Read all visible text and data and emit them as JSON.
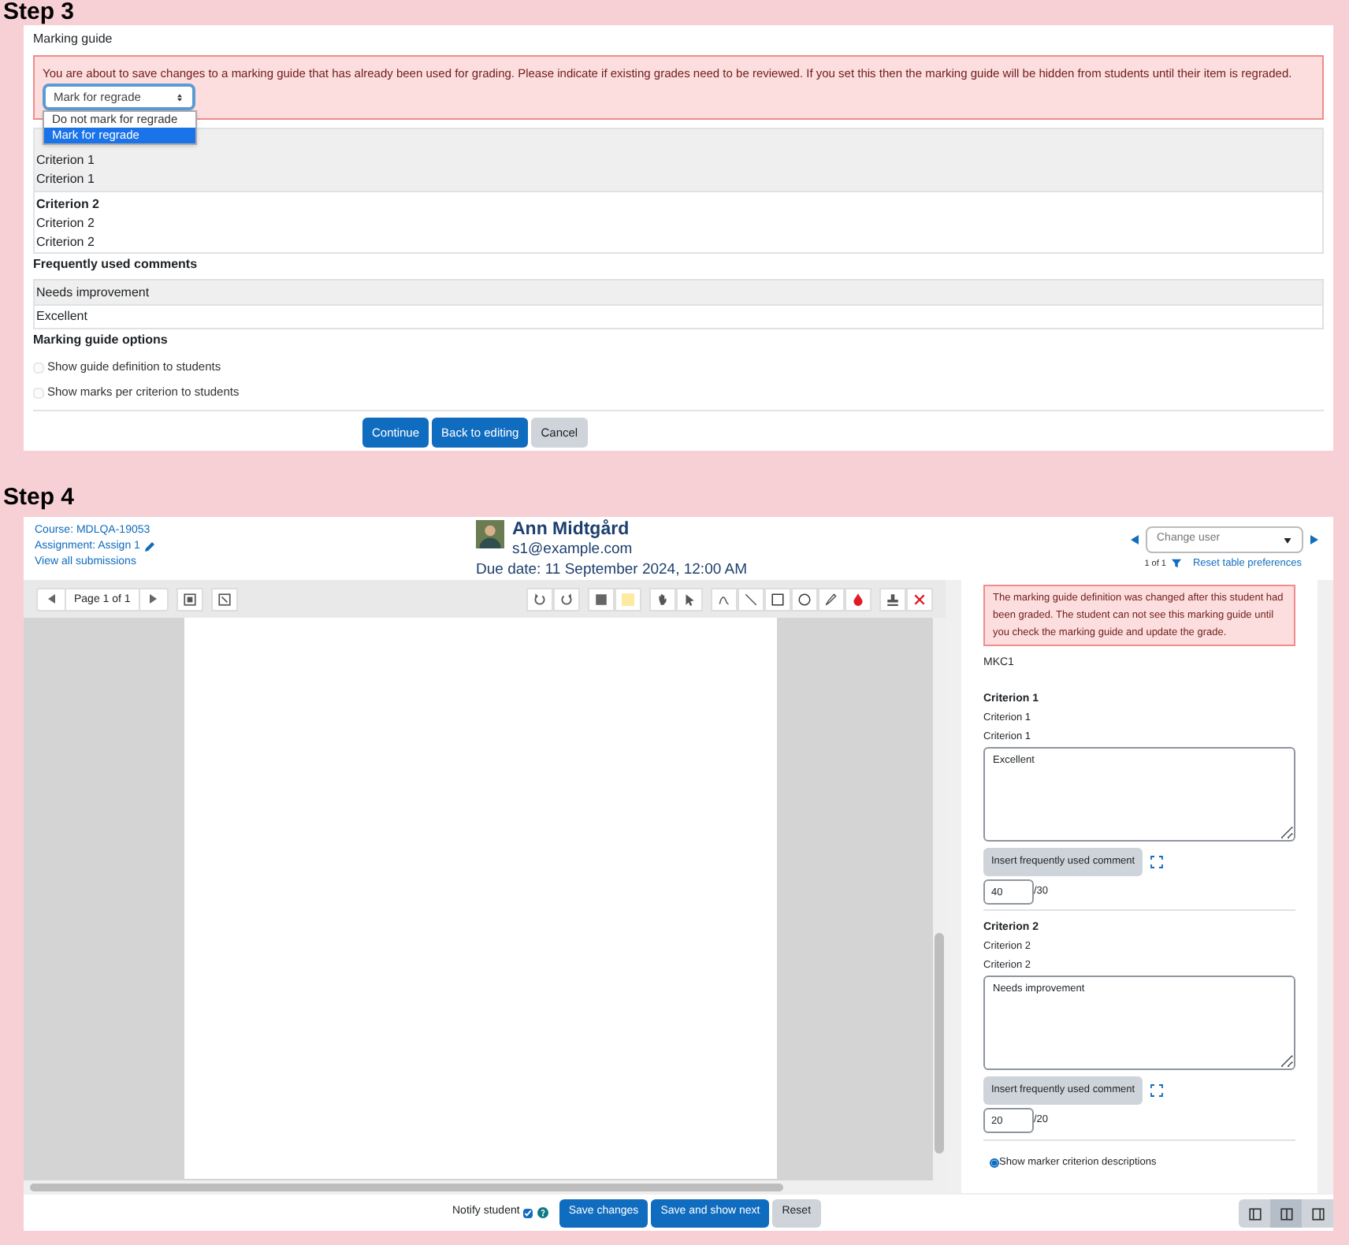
{
  "step3": {
    "heading": "Step 3",
    "section_title": "Marking guide",
    "warning": "You are about to save changes to a marking guide that has already been used for grading. Please indicate if existing grades need to be reviewed. If you set this then the marking guide will be hidden from students until their item is regraded.",
    "regrade_select": {
      "value": "Mark for regrade",
      "expanded": true,
      "options": [
        {
          "label": "Do not mark for regrade",
          "selected": false
        },
        {
          "label": "Mark for regrade",
          "selected": true
        }
      ]
    },
    "criteria": [
      {
        "lines": [
          "Criterion 1",
          "Criterion 1"
        ]
      },
      {
        "title": "Criterion 2",
        "lines": [
          "Criterion 2",
          "Criterion 2"
        ]
      }
    ],
    "comments_heading": "Frequently used comments",
    "comments": [
      "Needs improvement",
      "Excellent"
    ],
    "options_heading": "Marking guide options",
    "options": [
      {
        "label": "Show guide definition to students",
        "checked": false,
        "disabled": true
      },
      {
        "label": "Show marks per criterion to students",
        "checked": false,
        "disabled": true
      }
    ],
    "buttons": [
      {
        "label": "Continue",
        "kind": "primary"
      },
      {
        "label": "Back to editing",
        "kind": "primary"
      },
      {
        "label": "Cancel",
        "kind": "secondary"
      }
    ]
  },
  "step4": {
    "heading": "Step 4",
    "links": [
      {
        "label": "Course: MDLQA-19053",
        "edit": false
      },
      {
        "label": "Assignment: Assign 1",
        "edit": true
      },
      {
        "label": "View all submissions",
        "edit": false
      }
    ],
    "student": {
      "name": "Ann Midtgård",
      "email": "s1@example.com"
    },
    "due_date": "Due date: 11 September 2024, 12:00 AM",
    "user_select": {
      "placeholder": "Change user"
    },
    "pager": "1 of 1",
    "reset_link": "Reset table preferences",
    "page_label": "Page 1 of 1",
    "alert": "The marking guide definition was changed after this student had been graded. The student can not see this marking guide until you check the marking guide and update the grade.",
    "guide_title": "MKC1",
    "criteria": [
      {
        "title": "Criterion 1",
        "lines": [
          "Criterion 1",
          "Criterion 1"
        ],
        "comment": "Excellent",
        "insert_label": "Insert frequently used comment",
        "score": "40",
        "max": "/30"
      },
      {
        "title": "Criterion 2",
        "lines": [
          "Criterion 2",
          "Criterion 2"
        ],
        "comment": "Needs improvement",
        "insert_label": "Insert frequently used comment",
        "score": "20",
        "max": "/20"
      }
    ],
    "show_descriptions": {
      "label": "Show marker criterion descriptions",
      "checked": true
    },
    "notify": {
      "label": "Notify student",
      "checked": true
    },
    "buttons": [
      {
        "label": "Save changes",
        "kind": "primary"
      },
      {
        "label": "Save and show next",
        "kind": "primary"
      },
      {
        "label": "Reset",
        "kind": "secondary"
      }
    ],
    "layout_buttons": [
      {
        "selected": false
      },
      {
        "selected": true
      },
      {
        "selected": false
      }
    ]
  }
}
